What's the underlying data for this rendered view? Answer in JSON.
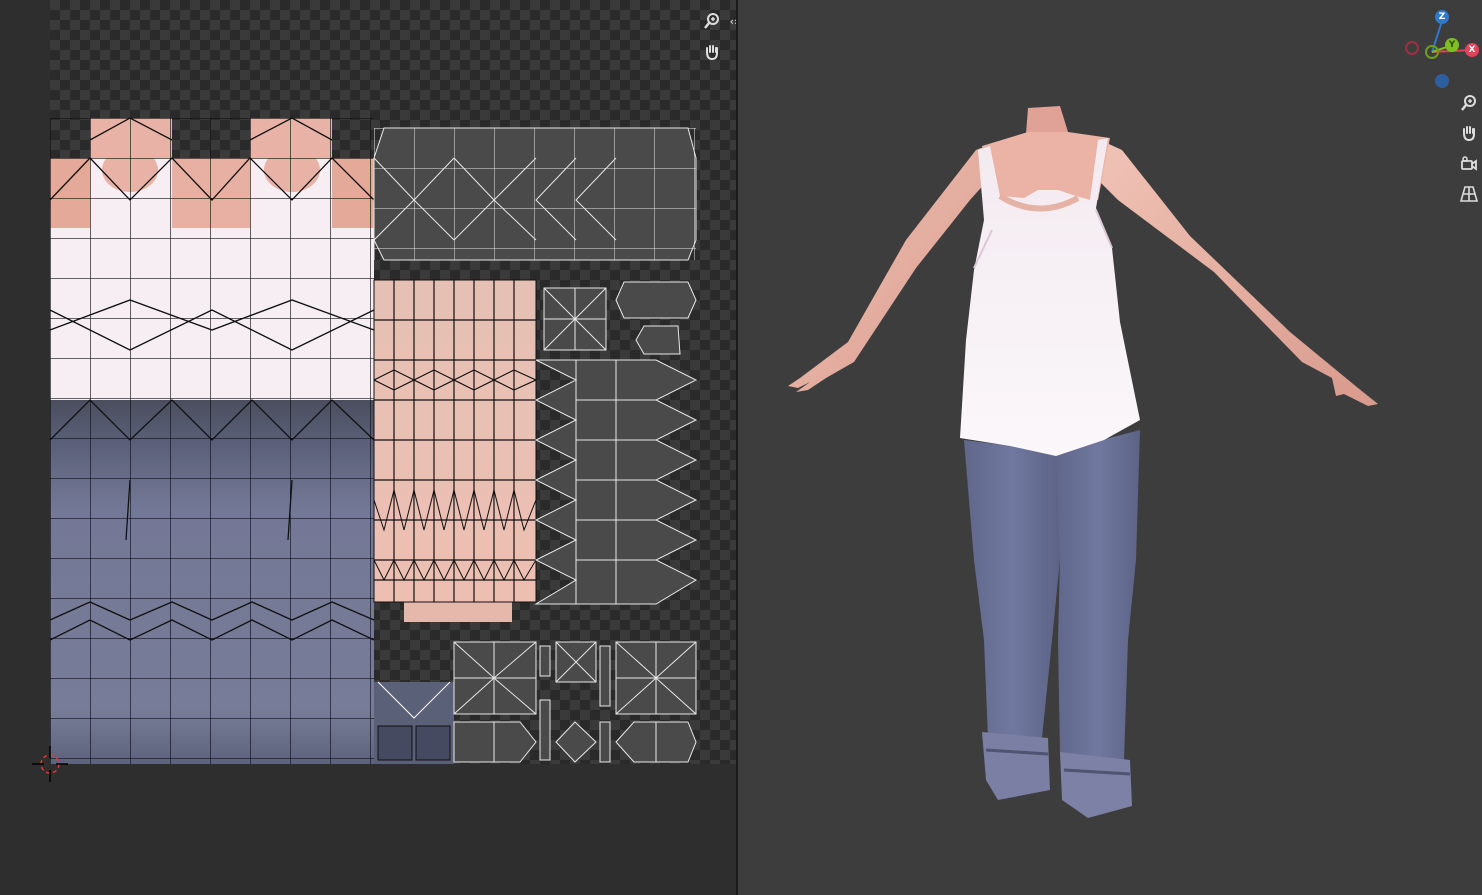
{
  "uv_editor": {
    "tools": {
      "zoom_icon": "zoom-icon",
      "pan_icon": "hand-icon",
      "collapse_icon": "chevrons-icon"
    },
    "colors": {
      "background": "#2e2e2e",
      "checker_light": "#3a3a3a",
      "checker_dark": "#2a2a2a",
      "uv_edges": "#111111",
      "vertex": "#000000",
      "top_white": "#f6f0f4",
      "skin": "#e8b6a8",
      "denim": "#6f7591",
      "gray_island": "#505050"
    }
  },
  "viewport": {
    "gizmo": {
      "z_label": "Z",
      "y_label": "Y",
      "x_label": "X",
      "colors": {
        "x": "#e2425a",
        "y": "#7fbf22",
        "z": "#2e7ad1"
      }
    },
    "tools": {
      "zoom_icon": "zoom-icon",
      "pan_icon": "hand-icon",
      "camera_icon": "camera-icon",
      "perspective_icon": "grid-perspective-icon"
    },
    "colors": {
      "background": "#3d3d3d",
      "skin": "#e8b0a3",
      "top": "#f8f2f6",
      "jeans": "#6b7193",
      "cuff": "#7a7fa0"
    }
  }
}
